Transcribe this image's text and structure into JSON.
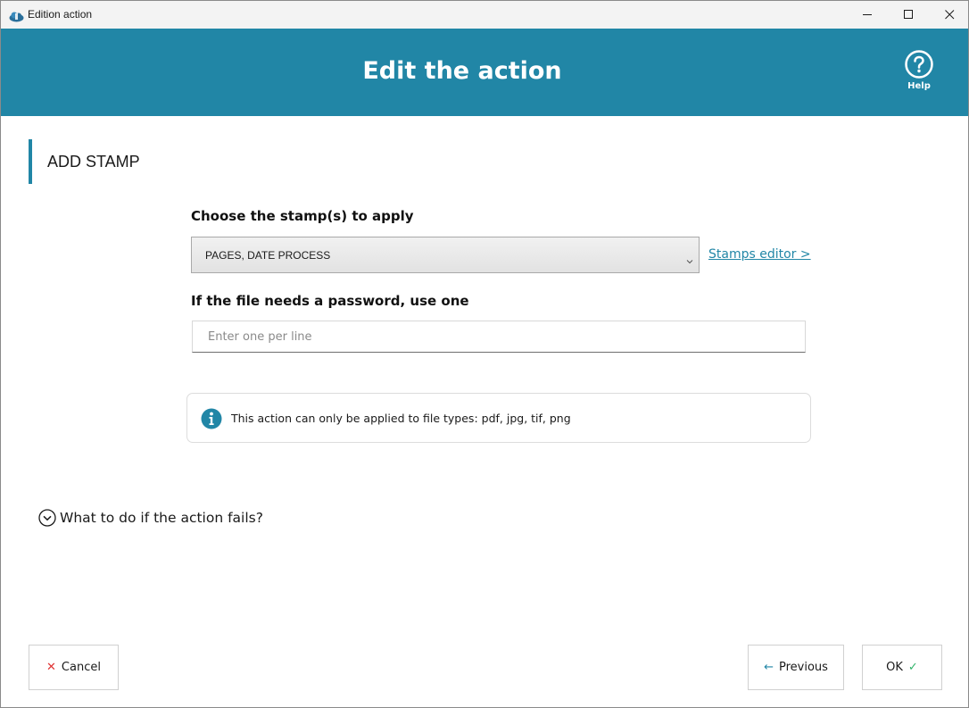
{
  "window": {
    "title": "Edition action",
    "icon": "app-cloud-icon"
  },
  "header": {
    "title": "Edit the action",
    "help_label": "Help",
    "background": "#2186a6"
  },
  "section": {
    "title": "ADD STAMP"
  },
  "stamp": {
    "label": "Choose the stamp(s) to apply",
    "selected": "PAGES, DATE PROCESS",
    "editor_link": "Stamps editor >"
  },
  "password": {
    "label": "If the file needs a password, use one",
    "placeholder": "Enter one per line",
    "value": ""
  },
  "info": {
    "text": "This action can only be applied to file types: pdf, jpg, tif, png",
    "icon": "info-icon"
  },
  "failure": {
    "toggle_label": "What to do if the action fails?"
  },
  "footer": {
    "cancel_label": "Cancel",
    "previous_label": "Previous",
    "ok_label": "OK"
  },
  "colors": {
    "accent": "#2186a6",
    "cancel": "#e03434",
    "ok": "#31b36a"
  }
}
